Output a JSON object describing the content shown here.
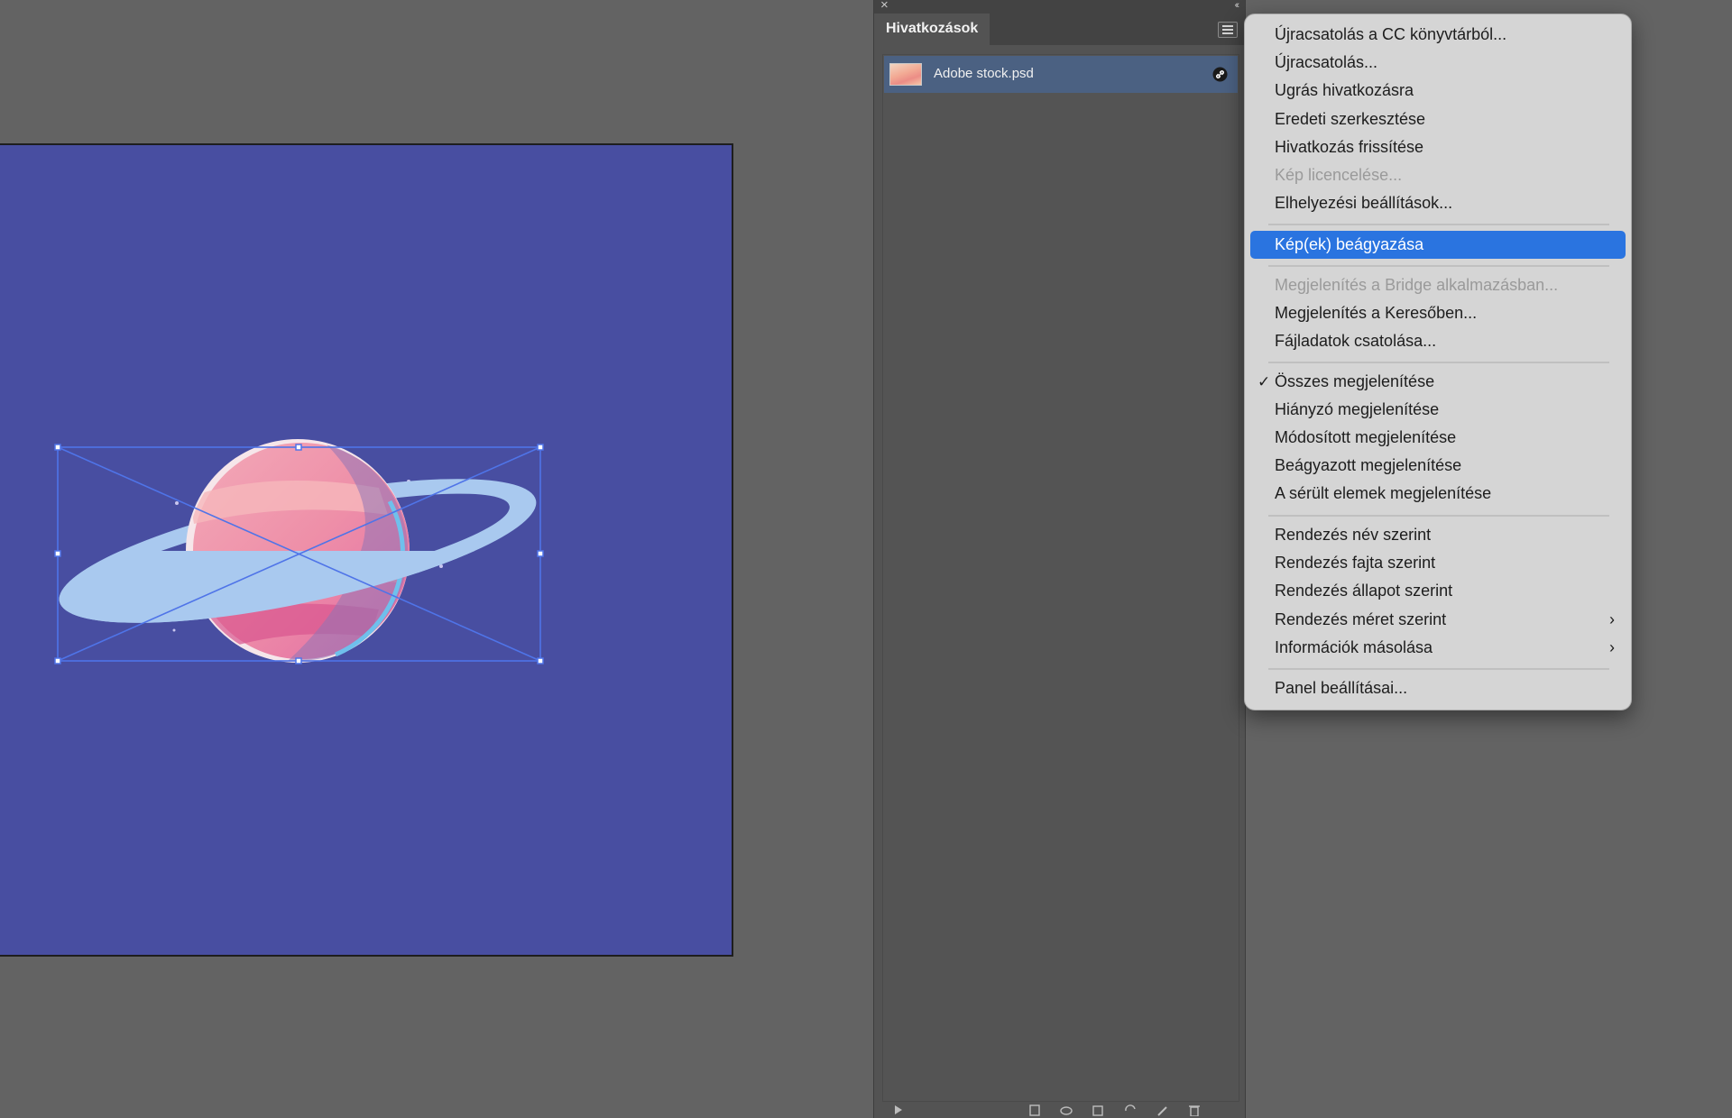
{
  "panel": {
    "title": "Hivatkozások",
    "links": [
      {
        "name": "Adobe stock.psd",
        "status": "linked"
      }
    ]
  },
  "context_menu": {
    "items": [
      {
        "label": "Újracsatolás a CC könyvtárból...",
        "enabled": true
      },
      {
        "label": "Újracsatolás...",
        "enabled": true
      },
      {
        "label": "Ugrás hivatkozásra",
        "enabled": true
      },
      {
        "label": "Eredeti szerkesztése",
        "enabled": true
      },
      {
        "label": "Hivatkozás frissítése",
        "enabled": true
      },
      {
        "label": "Kép licencelése...",
        "enabled": false
      },
      {
        "label": "Elhelyezési beállítások...",
        "enabled": true
      },
      {
        "label": "Kép(ek) beágyazása",
        "enabled": true,
        "highlighted": true
      },
      {
        "label": "Megjelenítés a Bridge alkalmazásban...",
        "enabled": false
      },
      {
        "label": "Megjelenítés a Keresőben...",
        "enabled": true
      },
      {
        "label": "Fájladatok csatolása...",
        "enabled": true
      },
      {
        "label": "Összes megjelenítése",
        "enabled": true,
        "checked": true
      },
      {
        "label": "Hiányzó megjelenítése",
        "enabled": true
      },
      {
        "label": "Módosított megjelenítése",
        "enabled": true
      },
      {
        "label": "Beágyazott megjelenítése",
        "enabled": true
      },
      {
        "label": "A sérült elemek megjelenítése",
        "enabled": true
      },
      {
        "label": "Rendezés név szerint",
        "enabled": true
      },
      {
        "label": "Rendezés fajta szerint",
        "enabled": true
      },
      {
        "label": "Rendezés állapot szerint",
        "enabled": true
      },
      {
        "label": "Rendezés méret szerint",
        "enabled": true,
        "submenu": true
      },
      {
        "label": "Információk másolása",
        "enabled": true,
        "submenu": true
      },
      {
        "label": "Panel beállításai...",
        "enabled": true
      }
    ]
  },
  "colors": {
    "artboard": "#484ea1",
    "selection": "#4f74e8",
    "menu_highlight": "#2a74e0",
    "panel_row_selected": "#4b6182"
  },
  "icons": {
    "panel_close": "close-icon",
    "panel_collapse": "double-chevron-left-icon",
    "panel_menu": "hamburger-menu-icon",
    "link_status": "link-icon",
    "checkmark": "checkmark-icon",
    "submenu": "chevron-right-icon"
  }
}
